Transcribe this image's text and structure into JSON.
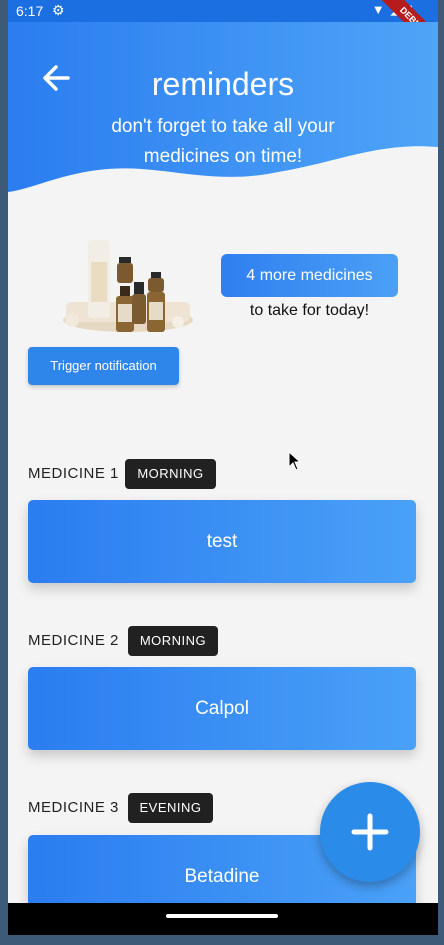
{
  "status_bar": {
    "time": "6:17",
    "settings_icon": "gear-icon",
    "right_icons": [
      "wifi-icon",
      "signal-icon",
      "battery-icon"
    ],
    "debug_banner": "DEBUG"
  },
  "header": {
    "back_icon": "arrow-left-icon",
    "title": "reminders",
    "subtitle": "don't forget to take all your medicines on time!"
  },
  "summary": {
    "more_medicines": "4 more medicines",
    "today_text": "to take for today!",
    "trigger_button": "Trigger notification"
  },
  "medicines": [
    {
      "label": "MEDICINE 1",
      "time": "MORNING",
      "name": "test"
    },
    {
      "label": "MEDICINE 2",
      "time": "MORNING",
      "name": "Calpol"
    },
    {
      "label": "MEDICINE 3",
      "time": "EVENING",
      "name": "Betadine"
    }
  ],
  "fab": {
    "icon": "plus-icon"
  },
  "colors": {
    "primary": "#2b7df0",
    "primary_light": "#4aa1f7",
    "tag_bg": "#212121",
    "background": "#f4f4f4"
  }
}
